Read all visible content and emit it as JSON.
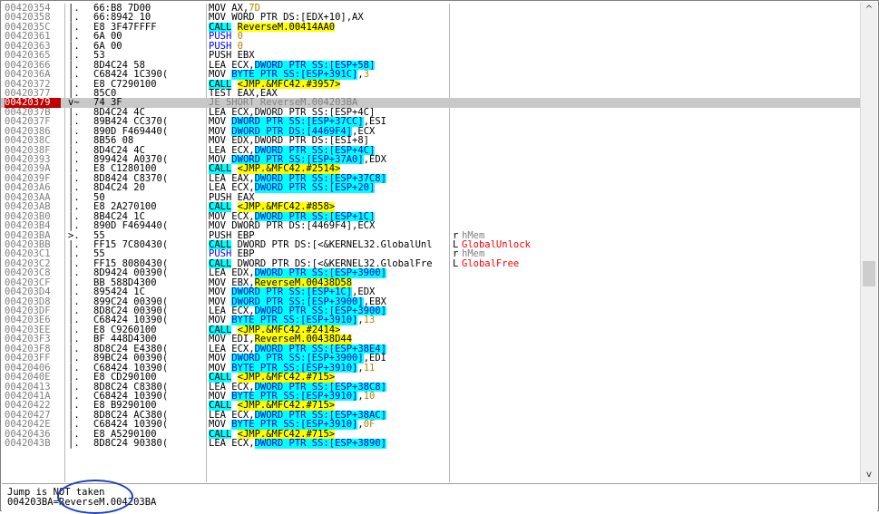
{
  "rows": [
    {
      "addr": "00420354",
      "mark": "|.",
      "hex": "66:B8 7D00",
      "instr": [
        [
          "t",
          "MOV AX,"
        ],
        [
          "imm",
          "7D"
        ]
      ],
      "comment": ""
    },
    {
      "addr": "00420358",
      "mark": "|.",
      "hex": "66:8942 10",
      "instr": [
        [
          "t",
          "MOV WORD PTR DS:[EDX+10],AX"
        ]
      ],
      "comment": ""
    },
    {
      "addr": "0042035C",
      "mark": "|.",
      "hex": "E8 3F47FFFF",
      "instr": [
        [
          "call",
          "CALL"
        ],
        [
          "t",
          " "
        ],
        [
          "tgt",
          "ReverseM.00414AA0"
        ]
      ],
      "comment": ""
    },
    {
      "addr": "00420361",
      "mark": "|.",
      "hex": "6A 00",
      "instr": [
        [
          "push",
          "PUSH "
        ],
        [
          "imm",
          "0"
        ]
      ],
      "comment": ""
    },
    {
      "addr": "00420363",
      "mark": "|.",
      "hex": "6A 00",
      "instr": [
        [
          "push",
          "PUSH "
        ],
        [
          "imm",
          "0"
        ]
      ],
      "comment": ""
    },
    {
      "addr": "00420365",
      "mark": "|.",
      "hex": "53",
      "instr": [
        [
          "t",
          "PUSH EBX"
        ]
      ],
      "comment": ""
    },
    {
      "addr": "00420366",
      "mark": "|.",
      "hex": "8D4C24 58",
      "instr": [
        [
          "t",
          "LEA ECX,"
        ],
        [
          "mem",
          "DWORD PTR SS:[ESP+58]"
        ]
      ],
      "comment": ""
    },
    {
      "addr": "0042036A",
      "mark": "|.",
      "hex": "C68424 1C390(",
      "instr": [
        [
          "t",
          "MOV "
        ],
        [
          "mem",
          "BYTE PTR SS:[ESP+391C]"
        ],
        [
          "t",
          ","
        ],
        [
          "imm",
          "3"
        ]
      ],
      "comment": ""
    },
    {
      "addr": "00420372",
      "mark": "|.",
      "hex": "E8 C7290100",
      "instr": [
        [
          "call",
          "CALL"
        ],
        [
          "t",
          " "
        ],
        [
          "tgt",
          "<JMP.&MFC42.#3957>"
        ]
      ],
      "comment": ""
    },
    {
      "addr": "00420377",
      "mark": "|.",
      "hex": "85C0",
      "instr": [
        [
          "t",
          "TEST EAX,EAX"
        ]
      ],
      "comment": ""
    },
    {
      "addr": "00420379",
      "mark": "v~",
      "hex": "74 3F",
      "instr": [
        [
          "t",
          "JE SHORT ReverseM.004203BA"
        ]
      ],
      "comment": "",
      "selected": true
    },
    {
      "addr": "0042037B",
      "mark": "|.",
      "hex": "8D4C24 4C",
      "instr": [
        [
          "g",
          "LEA ECX,DWORD PTR SS:[ESP+4C]"
        ]
      ],
      "comment": ""
    },
    {
      "addr": "0042037F",
      "mark": "|.",
      "hex": "89B424 CC370(",
      "instr": [
        [
          "t",
          "MOV "
        ],
        [
          "mem",
          "DWORD PTR SS:[ESP+37CC]"
        ],
        [
          "t",
          ",ESI"
        ]
      ],
      "comment": ""
    },
    {
      "addr": "00420386",
      "mark": "|.",
      "hex": "890D F469440(",
      "instr": [
        [
          "t",
          "MOV "
        ],
        [
          "mem",
          "DWORD PTR DS:[4469F4]"
        ],
        [
          "t",
          ",ECX"
        ]
      ],
      "comment": ""
    },
    {
      "addr": "0042038C",
      "mark": "|.",
      "hex": "8B56 08",
      "instr": [
        [
          "t",
          "MOV EDX,DWORD PTR DS:[ESI+8]"
        ]
      ],
      "comment": ""
    },
    {
      "addr": "0042038F",
      "mark": "|.",
      "hex": "8D4C24 4C",
      "instr": [
        [
          "t",
          "LEA ECX,"
        ],
        [
          "mem",
          "DWORD PTR SS:[ESP+4C]"
        ]
      ],
      "comment": ""
    },
    {
      "addr": "00420393",
      "mark": "|.",
      "hex": "899424 A0370(",
      "instr": [
        [
          "t",
          "MOV "
        ],
        [
          "mem",
          "DWORD PTR SS:[ESP+37A0]"
        ],
        [
          "t",
          ",EDX"
        ]
      ],
      "comment": ""
    },
    {
      "addr": "0042039A",
      "mark": "|.",
      "hex": "E8 C1280100",
      "instr": [
        [
          "call",
          "CALL"
        ],
        [
          "t",
          " "
        ],
        [
          "tgt",
          "<JMP.&MFC42.#2514>"
        ]
      ],
      "comment": ""
    },
    {
      "addr": "0042039F",
      "mark": "|.",
      "hex": "8D8424 C8370(",
      "instr": [
        [
          "t",
          "LEA EAX,"
        ],
        [
          "mem",
          "DWORD PTR SS:[ESP+37C8]"
        ]
      ],
      "comment": ""
    },
    {
      "addr": "004203A6",
      "mark": "|.",
      "hex": "8D4C24 20",
      "instr": [
        [
          "t",
          "LEA ECX,"
        ],
        [
          "mem",
          "DWORD PTR SS:[ESP+20]"
        ]
      ],
      "comment": ""
    },
    {
      "addr": "004203AA",
      "mark": "|.",
      "hex": "50",
      "instr": [
        [
          "t",
          "PUSH EAX"
        ]
      ],
      "comment": ""
    },
    {
      "addr": "004203AB",
      "mark": "|.",
      "hex": "E8 2A270100",
      "instr": [
        [
          "call",
          "CALL"
        ],
        [
          "t",
          " "
        ],
        [
          "tgt",
          "<JMP.&MFC42.#858>"
        ]
      ],
      "comment": ""
    },
    {
      "addr": "004203B0",
      "mark": "|.",
      "hex": "8B4C24 1C",
      "instr": [
        [
          "t",
          "MOV ECX,"
        ],
        [
          "mem",
          "DWORD PTR SS:[ESP+1C]"
        ]
      ],
      "comment": ""
    },
    {
      "addr": "004203B4",
      "mark": "|.",
      "hex": "890D F469440(",
      "instr": [
        [
          "t",
          "MOV DWORD PTR DS:[4469F4],ECX"
        ]
      ],
      "comment": ""
    },
    {
      "addr": "004203BA",
      "mark": ">.",
      "hex": "55",
      "instr": [
        [
          "t",
          "PUSH EBP"
        ]
      ],
      "comment": [
        [
          "br",
          "r"
        ],
        [
          "gray",
          "hMem"
        ]
      ]
    },
    {
      "addr": "004203BB",
      "mark": "|.",
      "hex": "FF15 7C80430(",
      "instr": [
        [
          "call",
          "CALL"
        ],
        [
          "t",
          " DWORD PTR DS:[<&KERNEL32.GlobalUnl"
        ]
      ],
      "comment": [
        [
          "br",
          "L"
        ],
        [
          "red",
          "GlobalUnlock"
        ]
      ]
    },
    {
      "addr": "004203C1",
      "mark": "|.",
      "hex": "55",
      "instr": [
        [
          "push",
          "PUSH "
        ],
        [
          "t",
          "EBP"
        ]
      ],
      "comment": [
        [
          "br",
          "r"
        ],
        [
          "gray",
          "hMem"
        ]
      ]
    },
    {
      "addr": "004203C2",
      "mark": "|.",
      "hex": "FF15 8080430(",
      "instr": [
        [
          "call",
          "CALL"
        ],
        [
          "t",
          " DWORD PTR DS:[<&KERNEL32.GlobalFre"
        ]
      ],
      "comment": [
        [
          "br",
          "L"
        ],
        [
          "red",
          "GlobalFree"
        ]
      ]
    },
    {
      "addr": "004203C8",
      "mark": "|.",
      "hex": "8D9424 00390(",
      "instr": [
        [
          "t",
          "LEA EDX,"
        ],
        [
          "mem",
          "DWORD PTR SS:[ESP+3900]"
        ]
      ],
      "comment": ""
    },
    {
      "addr": "004203CF",
      "mark": "|.",
      "hex": "BB 588D4300",
      "instr": [
        [
          "t",
          "MOV EBX,"
        ],
        [
          "tgt",
          "ReverseM.00438D58"
        ]
      ],
      "comment": ""
    },
    {
      "addr": "004203D4",
      "mark": "|.",
      "hex": "895424 1C",
      "instr": [
        [
          "t",
          "MOV "
        ],
        [
          "mem",
          "DWORD PTR SS:[ESP+1C]"
        ],
        [
          "t",
          ",EDX"
        ]
      ],
      "comment": ""
    },
    {
      "addr": "004203D8",
      "mark": "|.",
      "hex": "899C24 00390(",
      "instr": [
        [
          "t",
          "MOV "
        ],
        [
          "mem",
          "DWORD PTR SS:[ESP+3900]"
        ],
        [
          "t",
          ",EBX"
        ]
      ],
      "comment": ""
    },
    {
      "addr": "004203DF",
      "mark": "|.",
      "hex": "8D8C24 00390(",
      "instr": [
        [
          "t",
          "LEA ECX,"
        ],
        [
          "mem",
          "DWORD PTR SS:[ESP+3900]"
        ]
      ],
      "comment": ""
    },
    {
      "addr": "004203E6",
      "mark": "|.",
      "hex": "C68424 10390(",
      "instr": [
        [
          "t",
          "MOV "
        ],
        [
          "mem",
          "BYTE PTR SS:[ESP+3910]"
        ],
        [
          "t",
          ","
        ],
        [
          "imm",
          "13"
        ]
      ],
      "comment": ""
    },
    {
      "addr": "004203EE",
      "mark": "|.",
      "hex": "E8 C9260100",
      "instr": [
        [
          "call",
          "CALL"
        ],
        [
          "t",
          " "
        ],
        [
          "tgt",
          "<JMP.&MFC42.#2414>"
        ]
      ],
      "comment": ""
    },
    {
      "addr": "004203F3",
      "mark": "|.",
      "hex": "BF 448D4300",
      "instr": [
        [
          "t",
          "MOV EDI,"
        ],
        [
          "tgt",
          "ReverseM.00438D44"
        ]
      ],
      "comment": ""
    },
    {
      "addr": "004203F8",
      "mark": "|.",
      "hex": "8D8C24 E4380(",
      "instr": [
        [
          "t",
          "LEA ECX,"
        ],
        [
          "mem",
          "DWORD PTR SS:[ESP+38E4]"
        ]
      ],
      "comment": ""
    },
    {
      "addr": "004203FF",
      "mark": "|.",
      "hex": "89BC24 00390(",
      "instr": [
        [
          "t",
          "MOV "
        ],
        [
          "mem",
          "DWORD PTR SS:[ESP+3900]"
        ],
        [
          "t",
          ",EDI"
        ]
      ],
      "comment": ""
    },
    {
      "addr": "00420406",
      "mark": "|.",
      "hex": "C68424 10390(",
      "instr": [
        [
          "t",
          "MOV "
        ],
        [
          "mem",
          "BYTE PTR SS:[ESP+3910]"
        ],
        [
          "t",
          ","
        ],
        [
          "imm",
          "11"
        ]
      ],
      "comment": ""
    },
    {
      "addr": "0042040E",
      "mark": "|.",
      "hex": "E8 CD290100",
      "instr": [
        [
          "call",
          "CALL"
        ],
        [
          "t",
          " "
        ],
        [
          "tgt",
          "<JMP.&MFC42.#715>"
        ]
      ],
      "comment": ""
    },
    {
      "addr": "00420413",
      "mark": "|.",
      "hex": "8D8C24 C8380(",
      "instr": [
        [
          "t",
          "LEA ECX,"
        ],
        [
          "mem",
          "DWORD PTR SS:[ESP+38C8]"
        ]
      ],
      "comment": ""
    },
    {
      "addr": "0042041A",
      "mark": "|.",
      "hex": "C68424 10390(",
      "instr": [
        [
          "t",
          "MOV "
        ],
        [
          "mem",
          "BYTE PTR SS:[ESP+3910]"
        ],
        [
          "t",
          ","
        ],
        [
          "imm",
          "10"
        ]
      ],
      "comment": ""
    },
    {
      "addr": "00420422",
      "mark": "|.",
      "hex": "E8 B9290100",
      "instr": [
        [
          "call",
          "CALL"
        ],
        [
          "t",
          " "
        ],
        [
          "tgt",
          "<JMP.&MFC42.#715>"
        ]
      ],
      "comment": ""
    },
    {
      "addr": "00420427",
      "mark": "|.",
      "hex": "8D8C24 AC380(",
      "instr": [
        [
          "t",
          "LEA ECX,"
        ],
        [
          "mem",
          "DWORD PTR SS:[ESP+38AC]"
        ]
      ],
      "comment": ""
    },
    {
      "addr": "0042042E",
      "mark": "|.",
      "hex": "C68424 10390(",
      "instr": [
        [
          "t",
          "MOV "
        ],
        [
          "mem",
          "BYTE PTR SS:[ESP+3910]"
        ],
        [
          "t",
          ","
        ],
        [
          "imm",
          "0F"
        ]
      ],
      "comment": ""
    },
    {
      "addr": "00420436",
      "mark": "|.",
      "hex": "E8 A5290100",
      "instr": [
        [
          "call",
          "CALL"
        ],
        [
          "t",
          " "
        ],
        [
          "tgt",
          "<JMP.&MFC42.#715>"
        ]
      ],
      "comment": ""
    },
    {
      "addr": "0042043B",
      "mark": "|.",
      "hex": "8D8C24 90380(",
      "instr": [
        [
          "t",
          "LEA ECX,"
        ],
        [
          "mem",
          "DWORD PTR SS:[ESP+3890]"
        ]
      ],
      "comment": ""
    }
  ],
  "status": {
    "line1": "Jump is NOT taken",
    "line2": "004203BA=ReverseM.004203BA"
  },
  "scrollbar": {
    "up_icon": "caret-up-icon",
    "down_icon": "caret-down-icon",
    "up_glyph": "^",
    "down_glyph": "v"
  },
  "colors": {
    "selected_addr_bg": "#c00000",
    "call_bg": "#00ffff",
    "target_bg": "#ffff00",
    "memory_bg": "#00ffff",
    "api_name": "#ff0000",
    "annotation_circle": "#1e3fbf"
  }
}
